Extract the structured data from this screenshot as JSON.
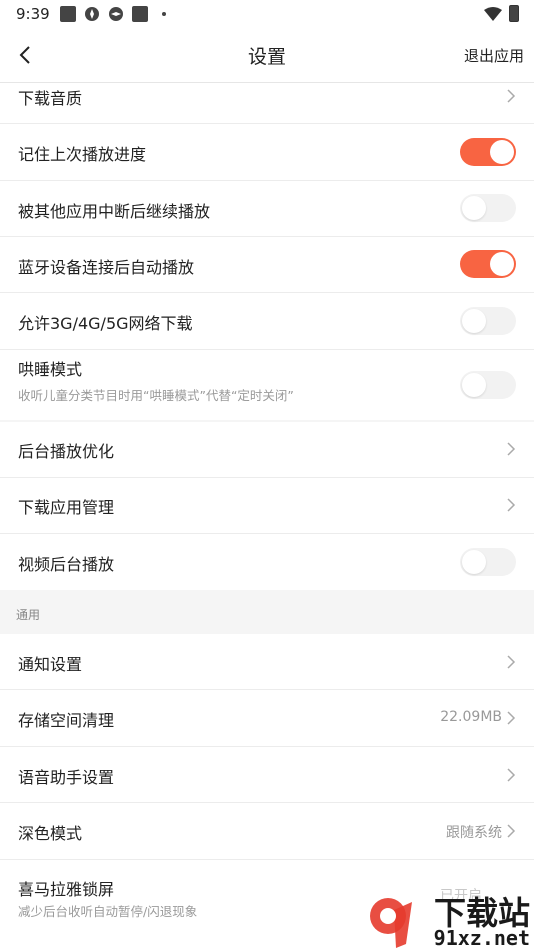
{
  "status_bar": {
    "time": "9:39"
  },
  "header": {
    "title": "设置",
    "exit_label": "退出应用"
  },
  "rows": {
    "download_quality": {
      "label": "下载音质"
    },
    "remember_progress": {
      "label": "记住上次播放进度",
      "on": true
    },
    "resume_after_interrupt": {
      "label": "被其他应用中断后继续播放",
      "on": false
    },
    "bluetooth_autoplay": {
      "label": "蓝牙设备连接后自动播放",
      "on": true
    },
    "mobile_download": {
      "label": "允许3G/4G/5G网络下载",
      "on": false
    },
    "sleep_mode": {
      "label": "哄睡模式",
      "sub": "收听儿童分类节目时用“哄睡模式”代替“定时关闭”",
      "on": false
    },
    "background_optimize": {
      "label": "后台播放优化"
    },
    "download_app_manage": {
      "label": "下载应用管理"
    },
    "video_background": {
      "label": "视频后台播放",
      "on": false
    },
    "section_general": {
      "label": "通用"
    },
    "notification": {
      "label": "通知设置"
    },
    "storage_clean": {
      "label": "存储空间清理",
      "value": "22.09MB"
    },
    "voice_assistant": {
      "label": "语音助手设置"
    },
    "dark_mode": {
      "label": "深色模式",
      "value": "跟随系统"
    },
    "lock_screen": {
      "label": "喜马拉雅锁屏",
      "sub": "减少后台收听自动暂停/闪退现象",
      "value": "已开启"
    }
  },
  "watermark": {
    "brand": "下载站",
    "url": "91xz.net"
  },
  "colors": {
    "accent": "#f86442",
    "toggle_off": "#f2f2f2",
    "section_bg": "#f5f5f5"
  }
}
